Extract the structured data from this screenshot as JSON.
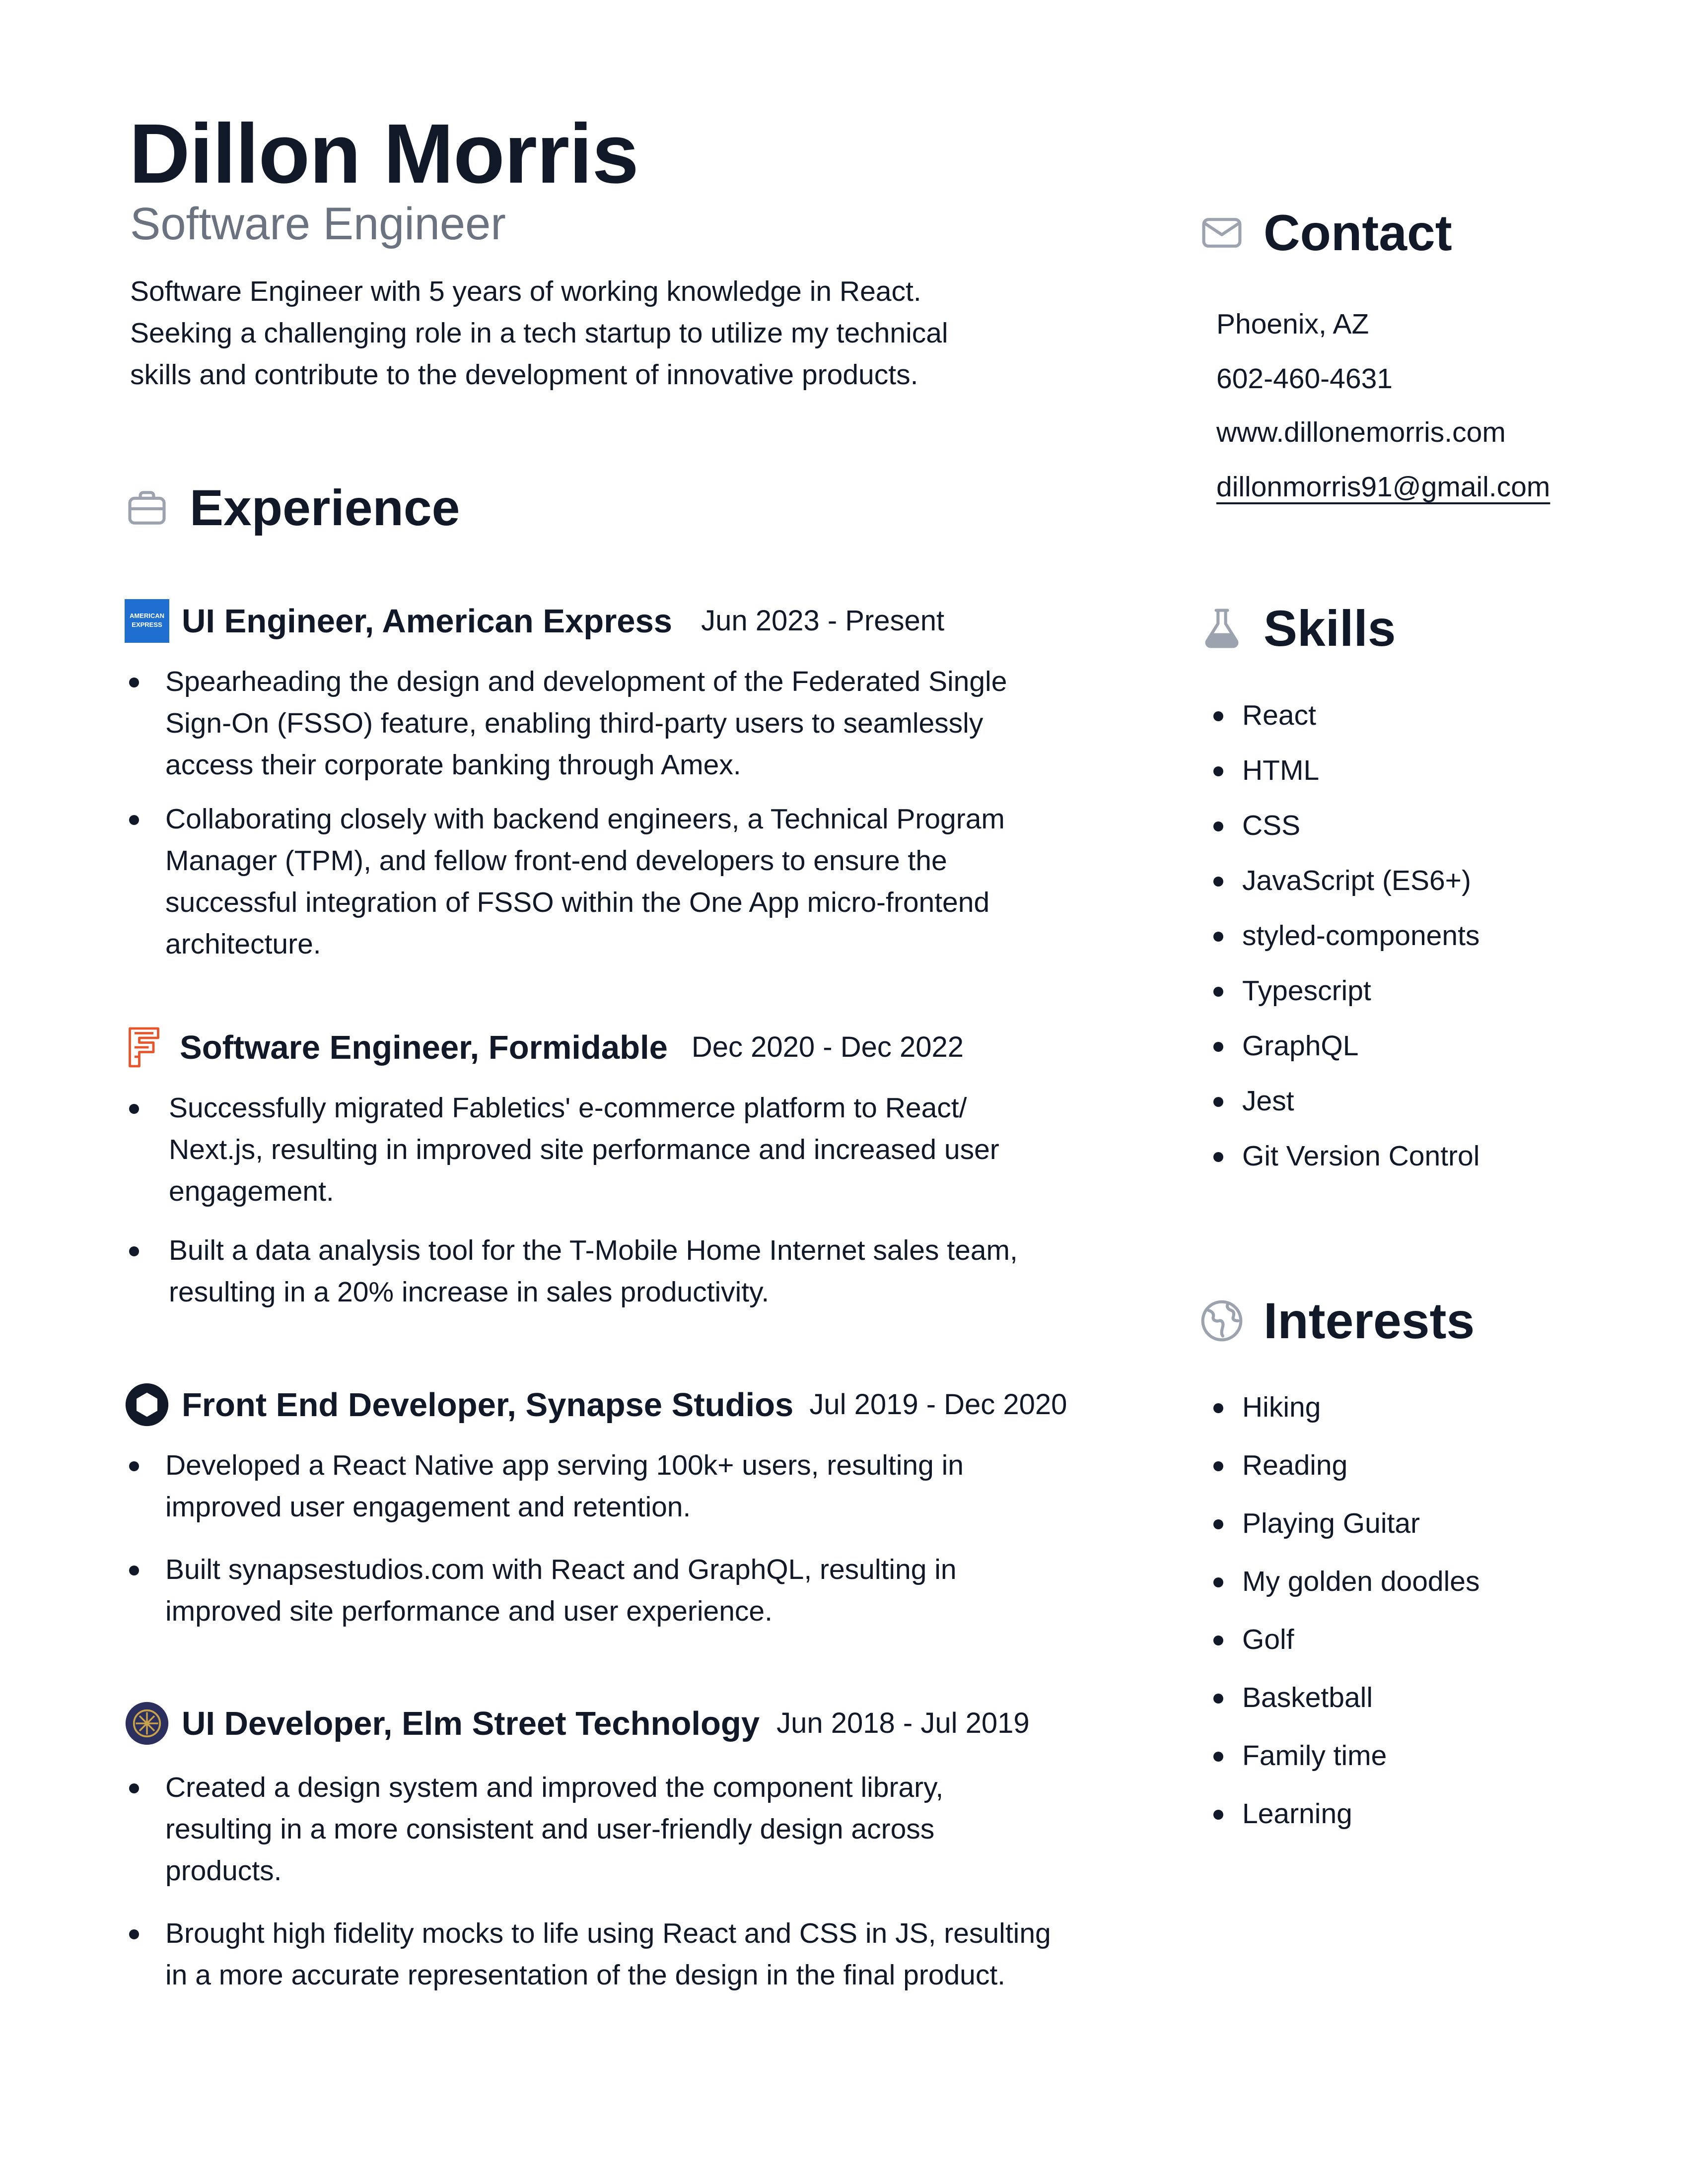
{
  "header": {
    "name": "Dillon Morris",
    "role": "Software Engineer",
    "summary_lines": [
      "Software Engineer with 5 years of working knowledge in React.",
      "Seeking a challenging role in a tech startup to utilize my technical",
      "skills and contribute to the development of innovative products."
    ]
  },
  "experience": {
    "heading": "Experience",
    "icon": "briefcase-icon",
    "jobs": [
      {
        "title": "UI Engineer, American Express",
        "dates": "Jun 2023 - Present",
        "logo": "american-express-logo",
        "logo_text": "AMERICAN EXPRESS",
        "bullets": [
          [
            "Spearheading the design and development of the Federated Single",
            "Sign-On (FSSO) feature, enabling third-party users to seamlessly",
            "access their corporate banking through Amex."
          ],
          [
            "Collaborating closely with backend engineers, a Technical Program",
            "Manager (TPM), and fellow front-end developers to ensure the",
            "successful integration of FSSO within the One App micro-frontend",
            "architecture."
          ]
        ]
      },
      {
        "title": "Software Engineer, Formidable",
        "dates": "Dec 2020 - Dec 2022",
        "logo": "formidable-logo",
        "bullets": [
          [
            "Successfully migrated Fabletics' e-commerce platform to React/",
            "Next.js, resulting in improved site performance and increased user",
            "engagement."
          ],
          [
            "Built a data analysis tool for the T-Mobile Home Internet sales team,",
            "resulting in a 20% increase in sales productivity."
          ]
        ]
      },
      {
        "title": "Front End Developer, Synapse Studios",
        "dates": "Jul 2019 - Dec 2020",
        "logo": "synapse-studios-logo",
        "bullets": [
          [
            "Developed a React Native app serving 100k+ users, resulting in",
            "improved user engagement and retention."
          ],
          [
            "Built synapsestudios.com with React and GraphQL, resulting in",
            "improved site performance and user experience."
          ]
        ]
      },
      {
        "title": "UI Developer, Elm Street Technology",
        "dates": "Jun 2018 - Jul 2019",
        "logo": "elm-street-technology-logo",
        "bullets": [
          [
            "Created a design system and improved the component library,",
            "resulting in a more consistent and user-friendly design across",
            "products."
          ],
          [
            "Brought high fidelity mocks to life using React and CSS in JS, resulting",
            "in a more accurate representation of the design in the final product."
          ]
        ]
      }
    ]
  },
  "contact": {
    "heading": "Contact",
    "icon": "envelope-icon",
    "location": "Phoenix, AZ",
    "phone": "602-460-4631",
    "website": "www.dillonemorris.com",
    "email": "dillonmorris91@gmail.com"
  },
  "skills": {
    "heading": "Skills",
    "icon": "flask-icon",
    "items": [
      "React",
      "HTML",
      "CSS",
      "JavaScript (ES6+)",
      "styled-components",
      "Typescript",
      "GraphQL",
      "Jest",
      "Git Version Control"
    ]
  },
  "interests": {
    "heading": "Interests",
    "icon": "globe-icon",
    "items": [
      "Hiking",
      "Reading",
      "Playing Guitar",
      "My golden doodles",
      "Golf",
      "Basketball",
      "Family time",
      "Learning"
    ]
  },
  "colors": {
    "text": "#111827",
    "muted": "#6b7280",
    "icon_gray": "#9ca3af",
    "amex_blue": "#1f6fd1",
    "formidable_orange": "#e8552b",
    "elm_navy": "#2b2f5e",
    "elm_gold": "#c9a24a"
  }
}
